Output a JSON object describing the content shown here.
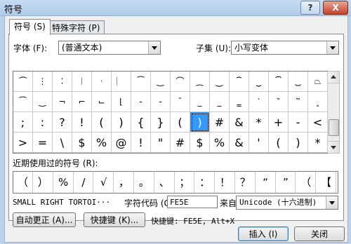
{
  "window": {
    "title": "符号",
    "help_label": "?",
    "close_label": "X"
  },
  "tabs": [
    {
      "label": "符号 (S)",
      "active": true
    },
    {
      "label": "特殊字符 (P)",
      "active": false
    }
  ],
  "font": {
    "label": "字体 (F):",
    "value": "(普通文本)"
  },
  "subset": {
    "label": "子集 (U):",
    "value": "小写变体"
  },
  "symbol_grid": {
    "rows": [
      [
        "⏜",
        "⋮",
        "︰",
        "︱",
        "︲",
        "︳",
        "⁀",
        "‿",
        "⌒",
        "⁔",
        "⏝",
        "⏞",
        "⏟",
        "⏠",
        "⏡",
        "⏢"
      ],
      [
        "⁀",
        "‿",
        "¬",
        "⌐",
        "⌙",
        "⌊",
        "‐",
        "‑",
        "¯",
        "_",
        "_",
        "‗",
        "‵",
        "‶",
        "‷",
        "‸"
      ],
      [
        ";",
        ":",
        "?",
        "!",
        "(",
        ")",
        "{",
        "}",
        "(",
        ")",
        "#",
        "&",
        "*",
        "+",
        "-",
        "<"
      ],
      [
        ">",
        "=",
        "\\",
        "$",
        "%",
        "@",
        "!",
        "\"",
        "#",
        "$",
        "%",
        "&",
        "'",
        "(",
        ")",
        "*"
      ]
    ],
    "selected_row": 2,
    "selected_col": 9
  },
  "recent": {
    "label": "近期使用过的符号 (R):",
    "symbols": [
      "（",
      "）",
      "%",
      "/",
      "√",
      "，",
      "。",
      "、",
      "；",
      "：",
      "！",
      "？",
      "“",
      "”",
      "（",
      "【"
    ]
  },
  "char_name": "SMALL RIGHT TORTOI···",
  "char_code": {
    "label": "字符代码 (C):",
    "value": "FE5E"
  },
  "from": {
    "label": "来自 (M):",
    "value": "Unicode (十六进制)"
  },
  "buttons": {
    "autocorrect": "自动更正 (A)...",
    "shortcut_key": "快捷键 (K)...",
    "insert": "插入 (I)",
    "close": "关闭"
  },
  "shortcut_text": "快捷键: FE5E, Alt+X"
}
